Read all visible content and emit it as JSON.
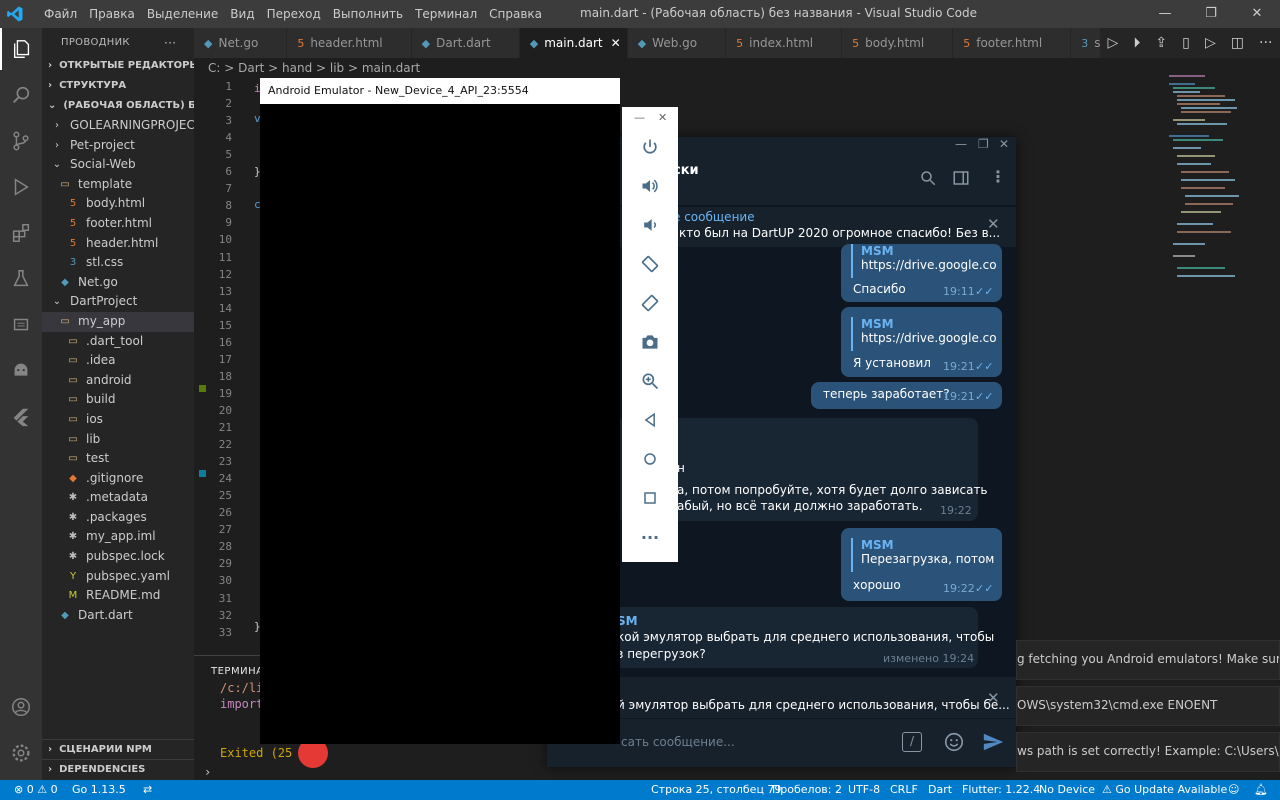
{
  "titlebar": {
    "menu": [
      "Файл",
      "Правка",
      "Выделение",
      "Вид",
      "Переход",
      "Выполнить",
      "Терминал",
      "Справка"
    ],
    "title": "main.dart - (Рабочая область) без названия - Visual Studio Code"
  },
  "sidebar": {
    "header": "ПРОВОДНИК",
    "more": "···",
    "sections": {
      "open_editors": "ОТКРЫТЫЕ РЕДАКТОРЫ",
      "structure": "СТРУКТУРА",
      "workspace": "(РАБОЧАЯ ОБЛАСТЬ) БЕЗ ...",
      "npm": "СЦЕНАРИИ NPM",
      "dependencies": "DEPENDENCIES"
    },
    "tree": [
      {
        "label": "GOLEARNINGPROJECT",
        "indent": 0,
        "icon": "chevron-right"
      },
      {
        "label": "Pet-project",
        "indent": 0,
        "icon": "chevron-right"
      },
      {
        "label": "Social-Web",
        "indent": 0,
        "icon": "chevron-down"
      },
      {
        "label": "template",
        "indent": 1,
        "icon": "folder"
      },
      {
        "label": "body.html",
        "indent": 2,
        "icon": "html"
      },
      {
        "label": "footer.html",
        "indent": 2,
        "icon": "html"
      },
      {
        "label": "header.html",
        "indent": 2,
        "icon": "html"
      },
      {
        "label": "stl.css",
        "indent": 2,
        "icon": "css"
      },
      {
        "label": "Net.go",
        "indent": 1,
        "icon": "go"
      },
      {
        "label": "DartProject",
        "indent": 0,
        "icon": "chevron-down"
      },
      {
        "label": "my_app",
        "indent": 1,
        "icon": "folder",
        "selected": true
      },
      {
        "label": ".dart_tool",
        "indent": 2,
        "icon": "folder"
      },
      {
        "label": ".idea",
        "indent": 2,
        "icon": "folder"
      },
      {
        "label": "android",
        "indent": 2,
        "icon": "folder"
      },
      {
        "label": "build",
        "indent": 2,
        "icon": "folder"
      },
      {
        "label": "ios",
        "indent": 2,
        "icon": "folder"
      },
      {
        "label": "lib",
        "indent": 2,
        "icon": "folder"
      },
      {
        "label": "test",
        "indent": 2,
        "icon": "folder"
      },
      {
        "label": ".gitignore",
        "indent": 2,
        "icon": "git"
      },
      {
        "label": ".metadata",
        "indent": 2,
        "icon": "asterisk"
      },
      {
        "label": ".packages",
        "indent": 2,
        "icon": "asterisk"
      },
      {
        "label": "my_app.iml",
        "indent": 2,
        "icon": "asterisk"
      },
      {
        "label": "pubspec.lock",
        "indent": 2,
        "icon": "asterisk"
      },
      {
        "label": "pubspec.yaml",
        "indent": 2,
        "icon": "yaml"
      },
      {
        "label": "README.md",
        "indent": 2,
        "icon": "md"
      },
      {
        "label": "Dart.dart",
        "indent": 1,
        "icon": "dart"
      }
    ]
  },
  "tabs": [
    {
      "label": "Net.go",
      "icon": "go",
      "active": false
    },
    {
      "label": "header.html",
      "icon": "html",
      "active": false
    },
    {
      "label": "Dart.dart",
      "icon": "dart",
      "active": false
    },
    {
      "label": "main.dart",
      "icon": "dart",
      "active": true
    },
    {
      "label": "Web.go",
      "icon": "go",
      "active": false
    },
    {
      "label": "index.html",
      "icon": "html",
      "active": false
    },
    {
      "label": "body.html",
      "icon": "html",
      "active": false
    },
    {
      "label": "footer.html",
      "icon": "html",
      "active": false
    },
    {
      "label": "st",
      "icon": "css",
      "active": false
    }
  ],
  "breadcrumb": "C: > Dart > hand > lib > main.dart",
  "line_numbers": [
    "1",
    "2",
    "3",
    "4",
    "5",
    "6",
    "7",
    "8",
    "9",
    "10",
    "11",
    "12",
    "13",
    "14",
    "15",
    "16",
    "17",
    "18",
    "19",
    "20",
    "21",
    "22",
    "23",
    "24",
    "25",
    "26",
    "27",
    "28",
    "29",
    "30",
    "31",
    "32",
    "33"
  ],
  "panel": {
    "tab": "ТЕРМИНАЛ",
    "lines": [
      "/c:/li",
      "import",
      "Exited (25"
    ]
  },
  "statusbar": {
    "errors": "⊗ 0 ⚠ 0",
    "go_version": "Go 1.13.5",
    "position": "Строка 25, столбец 79",
    "spaces": "Пробелов: 2",
    "encoding": "UTF-8",
    "eol": "CRLF",
    "language": "Dart",
    "flutter": "Flutter: 1.22.4",
    "device": "No Device",
    "go_update": "Go Update Available"
  },
  "emulator": {
    "title": "Android Emulator - New_Device_4_API_23:5554"
  },
  "telegram": {
    "chat_title": "ски",
    "pinned_label": "е сообщение",
    "pinned_text": "кто был на DartUP 2020 огромное спасибо!  Без в...",
    "messages": {
      "m1_name": "MSM",
      "m1_link": "https://drive.google.co...",
      "m1_text": "Спасибо",
      "m1_time": "19:11",
      "m2_name": "MSM",
      "m2_link": "https://drive.google.co...",
      "m2_text": "Я установил",
      "m2_time": "19:21",
      "m3_text": "теперь заработает?",
      "m3_time": "19:21",
      "in1_line1": "н",
      "in1_line2": "а, потом попробуйте, хотя будет долго зависать",
      "in1_line3": "абый, но всё таки должно заработать.",
      "in1_time": "19:22",
      "m4_name": "MSM",
      "m4_reply": "Перезагрузка, потом ...",
      "m4_text": "хорошо",
      "m4_time": "19:22",
      "in2_name": "SM",
      "in2_line1": "кой эмулятор выбрать для среднего использования, чтобы",
      "in2_line2": "з перегрузок?",
      "in2_time": "изменено 19:24"
    },
    "reply_preview": "й эмулятор выбрать для среднего использования, чтобы бе...",
    "input_placeholder": "сать сообщение..."
  },
  "notifications": [
    "g fetching you Android emulators! Make sure yo...",
    "OWS\\system32\\cmd.exe ENOENT",
    "ws path is set correctly! Example: C:\\Users\\Me\\..."
  ],
  "colors": {
    "accent": "#007acc",
    "tg_bubble_out": "#2b5278",
    "tg_bubble_in": "#182533",
    "tg_link": "#6ab3f3"
  }
}
